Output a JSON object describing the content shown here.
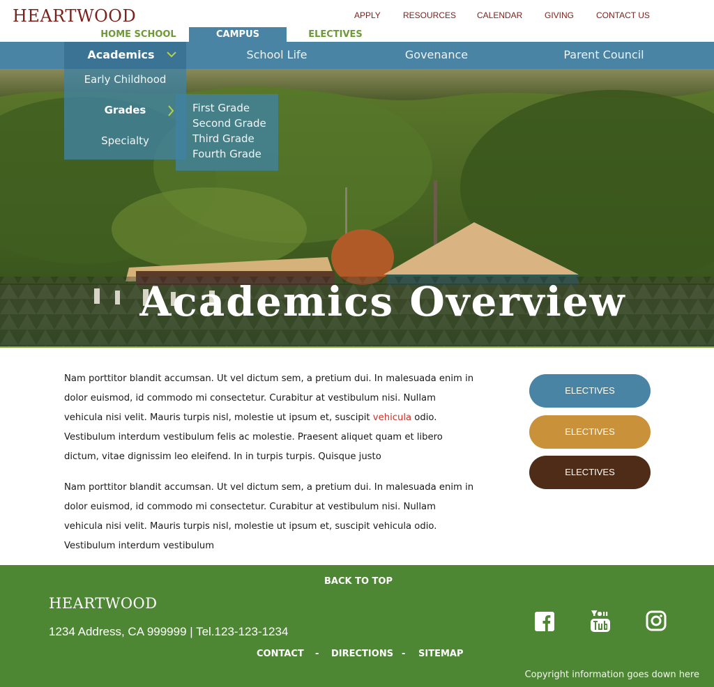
{
  "header": {
    "logo": "HEARTWOOD",
    "utility_nav": [
      "APPLY",
      "RESOURCES",
      "CALENDAR",
      "GIVING",
      "CONTACT US"
    ],
    "site_tabs": [
      {
        "label": "HOME SCHOOL",
        "active": false
      },
      {
        "label": "CAMPUS",
        "active": true
      },
      {
        "label": "ELECTIVES",
        "active": false
      }
    ]
  },
  "main_nav": {
    "items": [
      "Academics",
      "School Life",
      "Govenance",
      "Parent Council"
    ],
    "active": "Academics"
  },
  "dropdown": {
    "items": [
      "Early Childhood",
      "Grades",
      "Specialty"
    ],
    "active": "Grades",
    "submenu": [
      "First Grade",
      "Second Grade",
      "Third Grade",
      "Fourth Grade"
    ]
  },
  "hero": {
    "title": "Academics Overview"
  },
  "content": {
    "p1_before": "Nam porttitor blandit accumsan. Ut vel dictum sem, a pretium dui. In malesuada enim in dolor euismod, id commodo mi consectetur. Curabitur at vestibulum nisi. Nullam vehicula nisi velit. Mauris turpis nisl, molestie ut ipsum et, suscipit ",
    "p1_link": "vehicula",
    "p1_after": " odio. Vestibulum interdum vestibulum felis ac molestie. Praesent aliquet quam et libero dictum, vitae dignissim leo eleifend. In in turpis turpis. Quisque justo",
    "p2": "Nam porttitor blandit accumsan. Ut vel dictum sem, a pretium dui. In malesuada enim in dolor euismod, id commodo mi consectetur. Curabitur at vestibulum nisi. Nullam vehicula nisi velit. Mauris turpis nisl, molestie ut ipsum et, suscipit vehicula odio. Vestibulum interdum vestibulum"
  },
  "sidebar_buttons": [
    {
      "label": "ELECTIVES",
      "color": "#4a84a4"
    },
    {
      "label": "ELECTIVES",
      "color": "#c9913a"
    },
    {
      "label": "ELECTIVES",
      "color": "#4f2c17"
    }
  ],
  "footer": {
    "back_to_top": "BACK TO TOP",
    "logo": "HEARTWOOD",
    "address": "1234 Address, CA 999999 |  Tel.123-123-1234",
    "links": [
      "CONTACT",
      "-",
      "DIRECTIONS",
      "-",
      "SITEMAP"
    ],
    "social": [
      "facebook-icon",
      "youtube-icon",
      "instagram-icon"
    ],
    "copyright": "Copyright information goes down here"
  },
  "colors": {
    "brand_red": "#7a1f1a",
    "nav_blue": "#4a84a4",
    "green": "#4e8734",
    "link_red": "#c8322a",
    "gold": "#c9913a",
    "brown": "#4f2c17"
  }
}
